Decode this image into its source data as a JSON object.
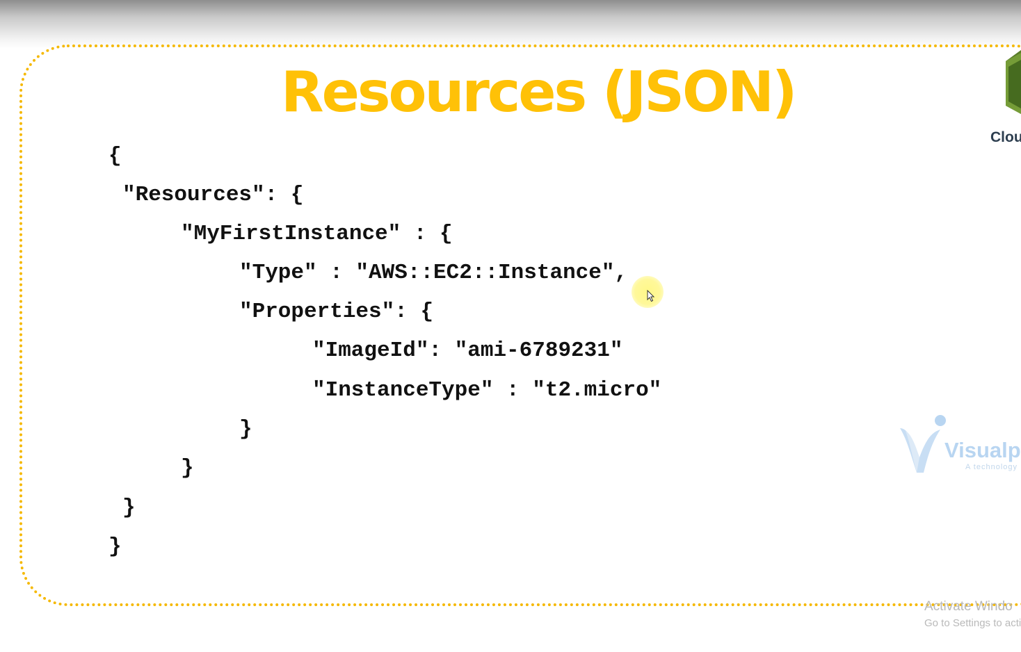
{
  "slide": {
    "title": "Resources (JSON)",
    "code_lines": [
      "{",
      "\"Resources\": {",
      "\"MyFirstInstance\" : {",
      "\"Type\" : \"AWS::EC2::Instance\",",
      "\"Properties\": {",
      "\"ImageId\": \"ami-6789231\"",
      "\"InstanceType\" : \"t2.micro\"",
      "}",
      "}",
      "}",
      "}"
    ]
  },
  "side_logo": {
    "label": "Clou",
    "icon": "cloudformation-cube-icon"
  },
  "watermark": {
    "name": "Visualpa",
    "tagline": "A technology",
    "icon": "visualpath-v-logo"
  },
  "windows_notice": {
    "title": "Activate Windo",
    "subtitle": "Go to Settings to acti"
  },
  "colors": {
    "title": "#ffc107",
    "frame": "#f5b800",
    "code_text": "#111111",
    "cursor_highlight": "#fff682"
  }
}
